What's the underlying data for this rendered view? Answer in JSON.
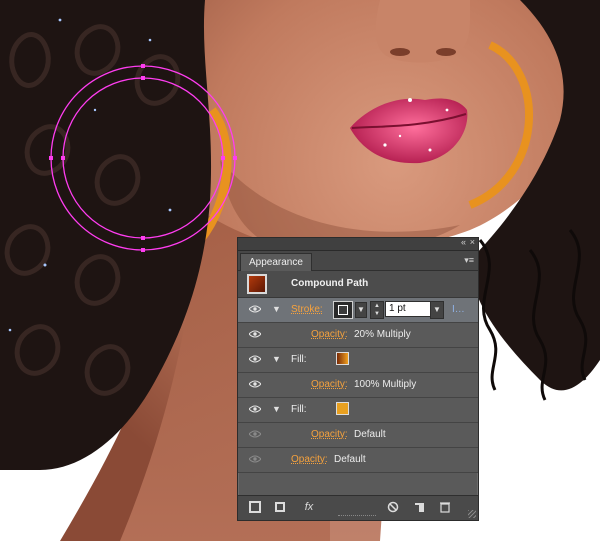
{
  "colors": {
    "selection": "#ff3df0",
    "hoop": "#e8921f",
    "accent_link": "#f6a23d",
    "panel_bg": "#5a5a5a"
  },
  "panel": {
    "tab_label": "Appearance",
    "collapse_icon": "«",
    "close_icon": "×",
    "menu_icon": "▾≡",
    "object_title": "Compound Path",
    "stroke": {
      "label": "Stroke:",
      "weight": "1 pt",
      "overflow": "I…"
    },
    "stroke_opacity": {
      "label": "Opacity:",
      "value": "20% Multiply"
    },
    "fill1": {
      "label": "Fill:",
      "swatch": "#e08a18"
    },
    "fill1_opacity": {
      "label": "Opacity:",
      "value": "100% Multiply"
    },
    "fill2": {
      "label": "Fill:",
      "swatch": "#e8a020"
    },
    "fill2_opacity": {
      "label": "Opacity:",
      "value": "Default"
    },
    "object_opacity": {
      "label": "Opacity:",
      "value": "Default"
    },
    "footer_icons": [
      "new-stroke-icon",
      "new-fill-icon",
      "add-effect-icon",
      "clear-appearance-icon",
      "duplicate-item-icon",
      "delete-item-icon"
    ],
    "fx_label": "fx"
  }
}
